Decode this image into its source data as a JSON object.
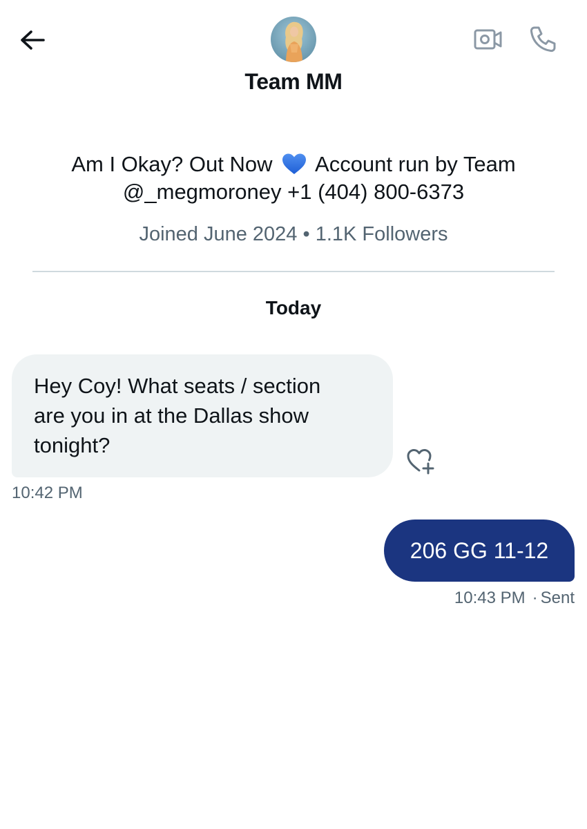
{
  "header": {
    "display_name": "Team MM",
    "back_icon": "arrow-left-icon",
    "video_icon": "video-camera-icon",
    "call_icon": "phone-icon"
  },
  "profile": {
    "bio_line1_before": "Am I Okay? Out Now",
    "bio_emoji": "blue-heart",
    "bio_line1_after": "Account run by Team",
    "bio_line2": "@_megmoroney +1 (404) 800-6373",
    "joined": "Joined June 2024",
    "separator": "•",
    "followers": "1.1K Followers"
  },
  "conversation": {
    "date_label": "Today",
    "messages": [
      {
        "direction": "received",
        "lines": [
          "Hey Coy! What seats / section",
          "are you in at the Dallas show",
          "tonight?"
        ],
        "time": "10:42 PM"
      },
      {
        "direction": "sent",
        "text": "206 GG 11-12",
        "time": "10:43 PM",
        "status": "Sent"
      }
    ]
  },
  "colors": {
    "sent_bubble": "#1b3580",
    "received_bubble": "#eff3f4",
    "muted_text": "#536471",
    "heart_blue": "#2f6fe0"
  }
}
